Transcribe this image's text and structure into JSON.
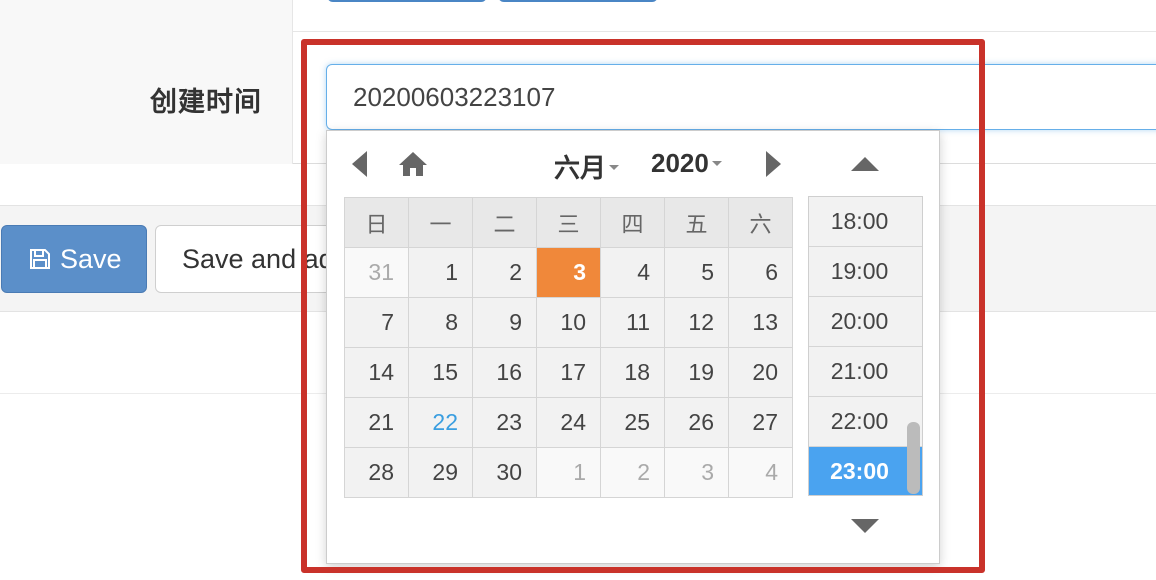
{
  "form": {
    "created_time_label": "创建时间",
    "created_time_value": "20200603223107"
  },
  "actions": {
    "save_label": "Save",
    "save_and_add_label": "Save and ad"
  },
  "datepicker": {
    "month": "六月",
    "year": "2020",
    "weekdays": [
      "日",
      "一",
      "二",
      "三",
      "四",
      "五",
      "六"
    ],
    "weeks": [
      [
        "31",
        "1",
        "2",
        "3",
        "4",
        "5",
        "6"
      ],
      [
        "7",
        "8",
        "9",
        "10",
        "11",
        "12",
        "13"
      ],
      [
        "14",
        "15",
        "16",
        "17",
        "18",
        "19",
        "20"
      ],
      [
        "21",
        "22",
        "23",
        "24",
        "25",
        "26",
        "27"
      ],
      [
        "28",
        "29",
        "30",
        "1",
        "2",
        "3",
        "4"
      ]
    ],
    "selected_day": "3",
    "highlighted_day": "22",
    "times": [
      "18:00",
      "19:00",
      "20:00",
      "21:00",
      "22:00",
      "23:00"
    ],
    "selected_time": "23:00"
  },
  "colors": {
    "selected_day": "#f0883a",
    "selected_time": "#4aa3f0",
    "highlight_box": "#c9322a",
    "primary_button": "#5b8fc9"
  }
}
